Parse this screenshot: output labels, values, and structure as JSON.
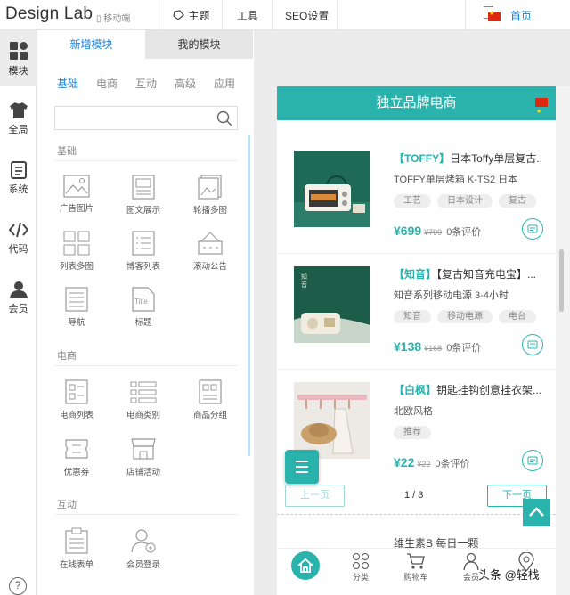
{
  "header": {
    "logo": "Design Lab",
    "mobile_label": "移动端",
    "nav": [
      "主题",
      "工具",
      "SEO设置"
    ],
    "home_label": "首页"
  },
  "leftnav": [
    {
      "label": "模块",
      "icon": "module-icon"
    },
    {
      "label": "全局",
      "icon": "shirt-icon"
    },
    {
      "label": "系统",
      "icon": "document-icon"
    },
    {
      "label": "代码",
      "icon": "code-icon"
    },
    {
      "label": "会员",
      "icon": "user-icon"
    }
  ],
  "panel": {
    "tabs": [
      "新增模块",
      "我的模块"
    ],
    "categories": [
      "基础",
      "电商",
      "互动",
      "高级",
      "应用"
    ],
    "sections": {
      "basic": {
        "title": "基础",
        "items": [
          "广告图片",
          "图文展示",
          "轮播多图",
          "列表多图",
          "博客列表",
          "滚动公告",
          "导航",
          "标题"
        ]
      },
      "ecommerce": {
        "title": "电商",
        "items": [
          "电商列表",
          "电商类别",
          "商品分组",
          "优惠券",
          "店铺活动"
        ]
      },
      "interactive": {
        "title": "互动",
        "items": [
          "在线表单",
          "会员登录"
        ]
      }
    }
  },
  "preview": {
    "title": "独立品牌电商",
    "products": [
      {
        "brand": "【TOFFY】",
        "title": "日本Toffy单层复古...",
        "subtitle": "TOFFY单层烤箱   K-TS2   日本",
        "tags": [
          "工艺",
          "日本设计",
          "复古"
        ],
        "price": "¥699",
        "old_price": "¥799",
        "reviews": "0条评价"
      },
      {
        "brand": "【知音】",
        "title": "【复古知音充电宝】...",
        "subtitle": "知音系列移动电源   3-4小时",
        "tags": [
          "知音",
          "移动电源",
          "电台"
        ],
        "price": "¥138",
        "old_price": "¥168",
        "reviews": "0条评价"
      },
      {
        "brand": "【白枫】",
        "title": "钥匙挂钩创意挂衣架...",
        "subtitle": "北欧风格",
        "tags": [
          "推荐"
        ],
        "price": "¥22",
        "old_price": "¥22",
        "reviews": "0条评价"
      }
    ],
    "pager": {
      "prev": "上一页",
      "info": "1 / 3",
      "next": "下一页"
    },
    "next_title": "维生素B 每日一颗",
    "bottom_nav": [
      "",
      "分类",
      "购物车",
      "会员",
      ""
    ]
  },
  "watermark": "头条 @轻栈"
}
